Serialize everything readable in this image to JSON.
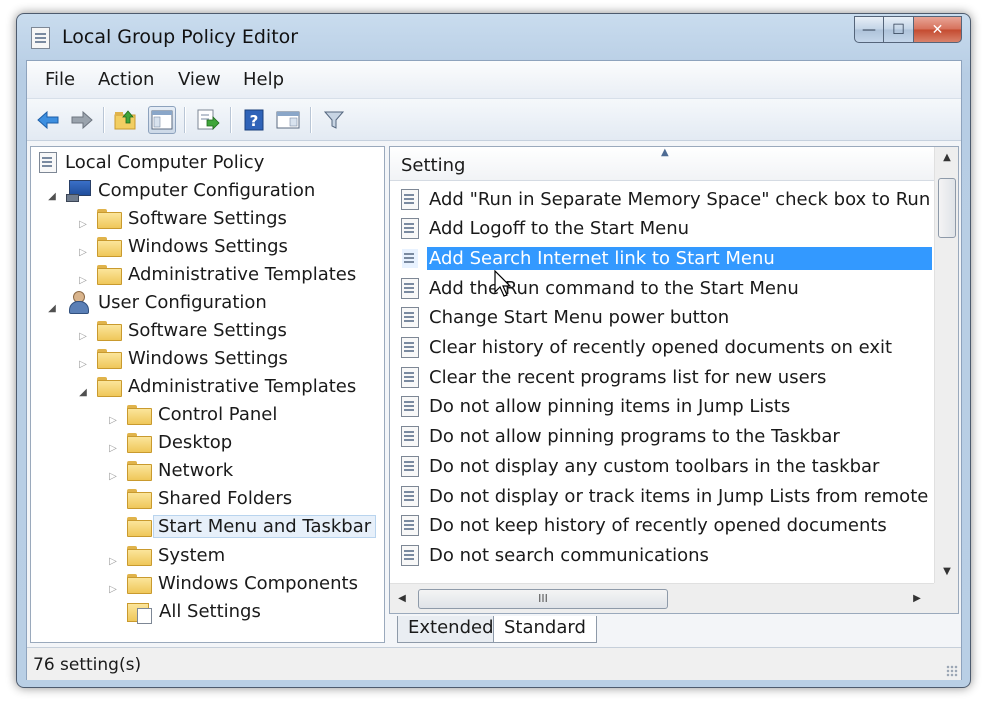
{
  "window": {
    "title": "Local Group Policy Editor",
    "controls": {
      "minimize": "—",
      "maximize": "☐",
      "close": "✕"
    }
  },
  "menu": [
    "File",
    "Action",
    "View",
    "Help"
  ],
  "toolbar": [
    {
      "name": "back-icon",
      "glyph": "🡄"
    },
    {
      "name": "forward-icon",
      "glyph": "🡆"
    },
    {
      "name": "up-folder-icon",
      "glyph": "📁"
    },
    {
      "name": "show-hide-tree-icon",
      "glyph": "▤"
    },
    {
      "name": "export-list-icon",
      "glyph": "⇨"
    },
    {
      "name": "help-icon",
      "glyph": "?"
    },
    {
      "name": "properties-icon",
      "glyph": "▥"
    },
    {
      "name": "filter-icon",
      "glyph": "⏷"
    }
  ],
  "tree": {
    "root": "Local Computer Policy",
    "computer_configuration": "Computer Configuration",
    "computer_children": [
      "Software Settings",
      "Windows Settings",
      "Administrative Templates"
    ],
    "user_configuration": "User Configuration",
    "user_children": [
      "Software Settings",
      "Windows Settings",
      "Administrative Templates"
    ],
    "admin_templates_children": [
      "Control Panel",
      "Desktop",
      "Network",
      "Shared Folders",
      "Start Menu and Taskbar",
      "System",
      "Windows Components",
      "All Settings"
    ],
    "selected": "Start Menu and Taskbar"
  },
  "list": {
    "column_header": "Setting",
    "selected_index": 2,
    "rows": [
      "Add \"Run in Separate Memory Space\" check box to Run dial...",
      "Add Logoff to the Start Menu",
      "Add Search Internet link to Start Menu",
      "Add the Run command to the Start Menu",
      "Change Start Menu power button",
      "Clear history of recently opened documents on exit",
      "Clear the recent programs list for new users",
      "Do not allow pinning items in Jump Lists",
      "Do not allow pinning programs to the Taskbar",
      "Do not display any custom toolbars in the taskbar",
      "Do not display or track items in Jump Lists from remote loca...",
      "Do not keep history of recently opened documents",
      "Do not search communications"
    ],
    "hscroll_grip": "III"
  },
  "tabs": {
    "extended": "Extended",
    "standard": "Standard",
    "active": "Standard"
  },
  "status": {
    "text": "76 setting(s)"
  },
  "colors": {
    "selection": "#3399ff",
    "frame": "#b9cfe5"
  }
}
